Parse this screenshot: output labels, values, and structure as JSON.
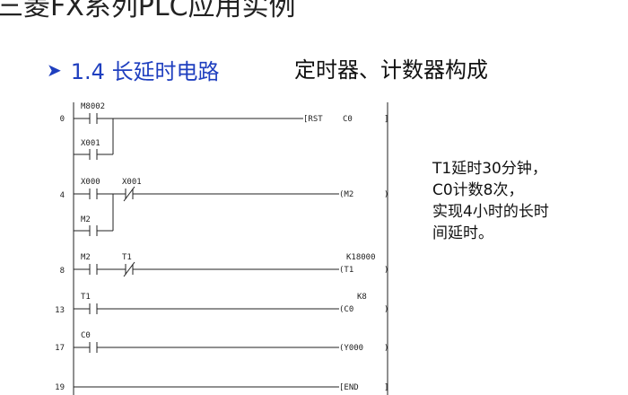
{
  "header": {
    "title": "三菱FX系列PLC应用实例"
  },
  "section": {
    "arrow": "➤",
    "title": "1.4 长延时电路",
    "subtitle": "定时器、计数器构成"
  },
  "ladder": {
    "rungs": [
      {
        "step": "0",
        "contacts": [
          "M8002",
          "X001"
        ],
        "instr": "[RST",
        "operand": "C0",
        "value": ""
      },
      {
        "step": "4",
        "contacts": [
          "X000",
          "X001",
          "M2"
        ],
        "instr": "(M2",
        "operand": "",
        "value": ""
      },
      {
        "step": "8",
        "contacts": [
          "M2",
          "T1"
        ],
        "instr": "(T1",
        "operand": "",
        "value": "K18000"
      },
      {
        "step": "13",
        "contacts": [
          "T1"
        ],
        "instr": "(C0",
        "operand": "",
        "value": "K8"
      },
      {
        "step": "17",
        "contacts": [
          "C0"
        ],
        "instr": "(Y000",
        "operand": "",
        "value": ""
      },
      {
        "step": "19",
        "contacts": [],
        "instr": "[END",
        "operand": "",
        "value": ""
      }
    ]
  },
  "notes": {
    "line1": "T1延时30分钟，",
    "line2": "C0计数8次，",
    "line3": "实现4小时的长时",
    "line4": "间延时。"
  }
}
